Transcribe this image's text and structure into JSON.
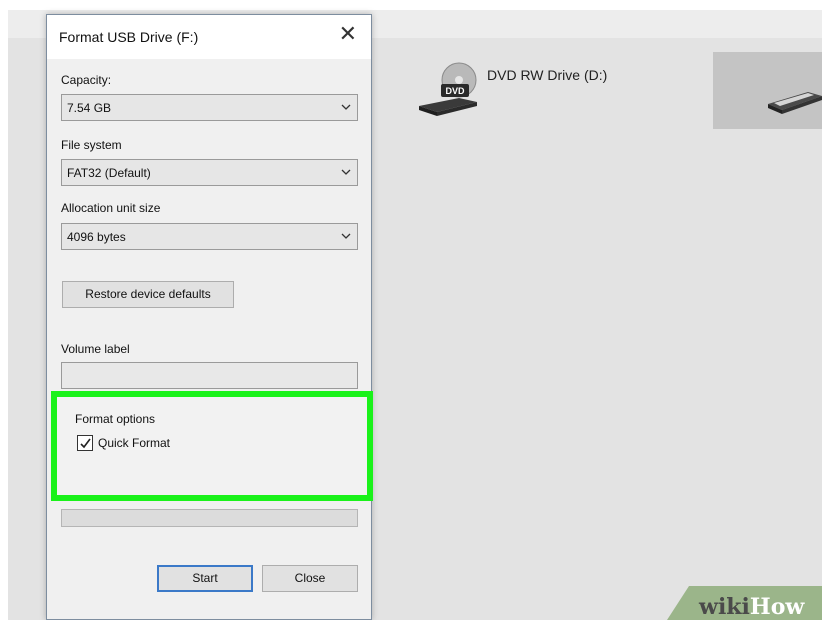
{
  "dialog": {
    "title": "Format USB Drive (F:)",
    "close_glyph": "✕",
    "capacity": {
      "label": "Capacity:",
      "value": "7.54 GB"
    },
    "file_system": {
      "label": "File system",
      "value": "FAT32 (Default)"
    },
    "allocation_unit": {
      "label": "Allocation unit size",
      "value": "4096 bytes"
    },
    "restore_button": "Restore device defaults",
    "volume_label": {
      "label": "Volume label",
      "value": ""
    },
    "format_options": {
      "group_label": "Format options",
      "quick_format": {
        "label": "Quick Format",
        "checked": true
      }
    },
    "start_button": "Start",
    "close_button": "Close"
  },
  "explorer": {
    "drives": [
      {
        "name": "DVD RW Drive (D:)",
        "icon": "dvd-drive-icon",
        "badge": "DVD"
      },
      {
        "name": "",
        "icon": "usb-drive-icon"
      }
    ]
  },
  "highlight_color": "#1af21a",
  "watermark": {
    "part1": "wiki",
    "part2": "How"
  }
}
